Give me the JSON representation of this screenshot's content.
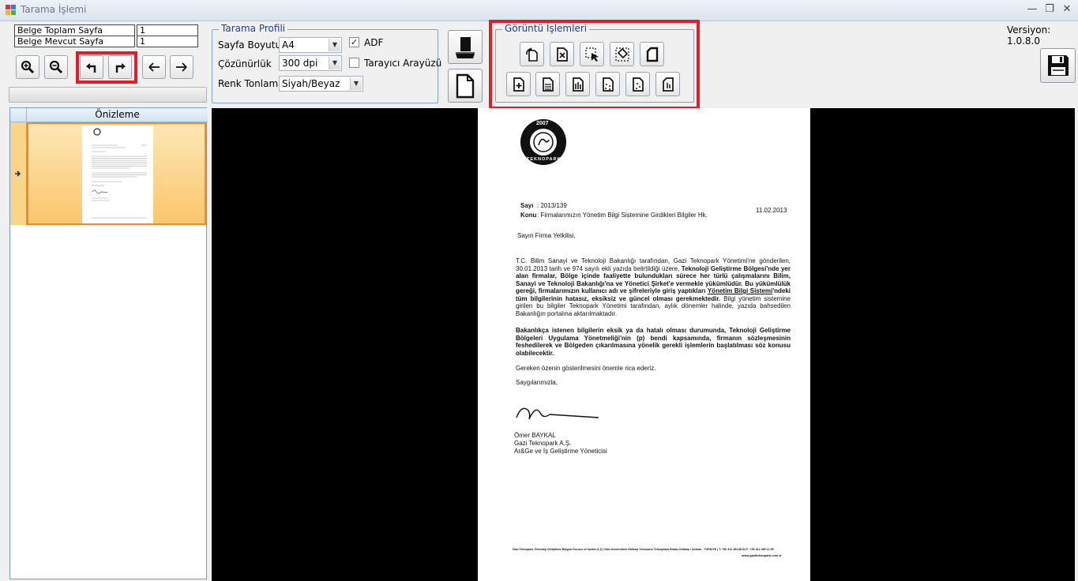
{
  "window": {
    "title": "Tarama İşlemi"
  },
  "info": {
    "total_pages_label": "Belge Toplam Sayfa",
    "total_pages_value": "1",
    "current_page_label": "Belge Mevcut Sayfa",
    "current_page_value": "1"
  },
  "preview": {
    "column_header": "Önizleme"
  },
  "scan_profile": {
    "title": "Tarama Profili",
    "page_size_label": "Sayfa Boyutu",
    "page_size_value": "A4",
    "resolution_label": "Çözünürlük",
    "resolution_value": "300 dpi",
    "color_label": "Renk Tonlama",
    "color_value": "Siyah/Beyaz",
    "adf_label": "ADF",
    "adf_checked": true,
    "scanner_ui_label": "Tarayıcı Arayüzü",
    "scanner_ui_checked": false
  },
  "image_ops": {
    "title": "Görüntü İşlemleri"
  },
  "version": "Versiyon: 1.0.8.0",
  "document": {
    "logo_year": "2007",
    "logo_text": "TEKNOPARK",
    "sayi_label": "Sayı",
    "sayi_value": ": 2013/139",
    "date": "11.02.2013",
    "konu_label": "Konu",
    "konu_value": ": Firmalarımızın Yönetim Bilgi Sistemine Girdikleri Bilgiler Hk.",
    "greeting": "Sayın Firma Yetkilisi,",
    "para1_a": "T.C. Bilim Sanayi ve Teknoloji Bakanlığı tarafından, Gazi Teknopark Yönetimi'ne gönderilen, 30.01.2013 tarih ve 974 sayılı ekli yazıda belirtildiği üzere,",
    "para1_b": "Teknoloji Geliştirme Bölgesi'nde yer alan firmalar, Bölge içinde faaliyette bulundukları sürece her türlü çalışmalarını Bilim, Sanayi ve Teknoloji Bakanlığı'na ve Yönetici Şirket'e vermekle yükümlüdür. Bu yükümlülük gereği, firmalarımızın kullanıcı adı ve şifreleriyle giriş yaptıkları",
    "para1_link": "Yönetim Bilgi Sistemi",
    "para1_c": "'ndeki tüm bilgilerinin hatasız, eksiksiz ve güncel olması gerekmektedir.",
    "para1_d": "Bilgi yönetim sistemine girilen bu bilgiler Teknopark Yönetimi tarafından, aylık dönemler halinde, yazıda bahsedilen Bakanlığın portalına aktarılmaktadır.",
    "para2": "Bakanlıkça istenen bilgilerin eksik ya da hatalı olması durumunda, Teknoloji Geliştirme Bölgeleri Uygulama Yönetmeliği'nin (p) bendi kapsamında, firmanın sözleşmesinin feshedilerek ve Bölgeden çıkarılmasına yönelik gerekli işlemlerin başlatılması söz konusu olabilecektir.",
    "para3": "Gereken özenin gösterilmesini önemle rica ederiz.",
    "closing": "Saygılarımızla,",
    "signer_name": "Ömer BAYKAL",
    "signer_company": "Gazi Teknopark A.Ş.",
    "signer_title": "Ar&Ge ve İş Geliştirme Yöneticisi",
    "footer_line1": "Gazi Teknopark Teknoloji Geliştirme Bölgesi Kurucu ve İşletici A.Ş | Gazi Üniversitesi Gölbaşı Yerleşkesi Teknoplaza Binası Gölbaşı / Ankara - TÜRKİYE | T: +90 312 484 88 63 F: +90 312 485 14 59",
    "footer_line2": "www.gaziteknopark.com.tr"
  },
  "colors": {
    "highlight_box": "#e01e2a",
    "group_title": "#1c3f94",
    "selected_row": "#fbc66d"
  }
}
